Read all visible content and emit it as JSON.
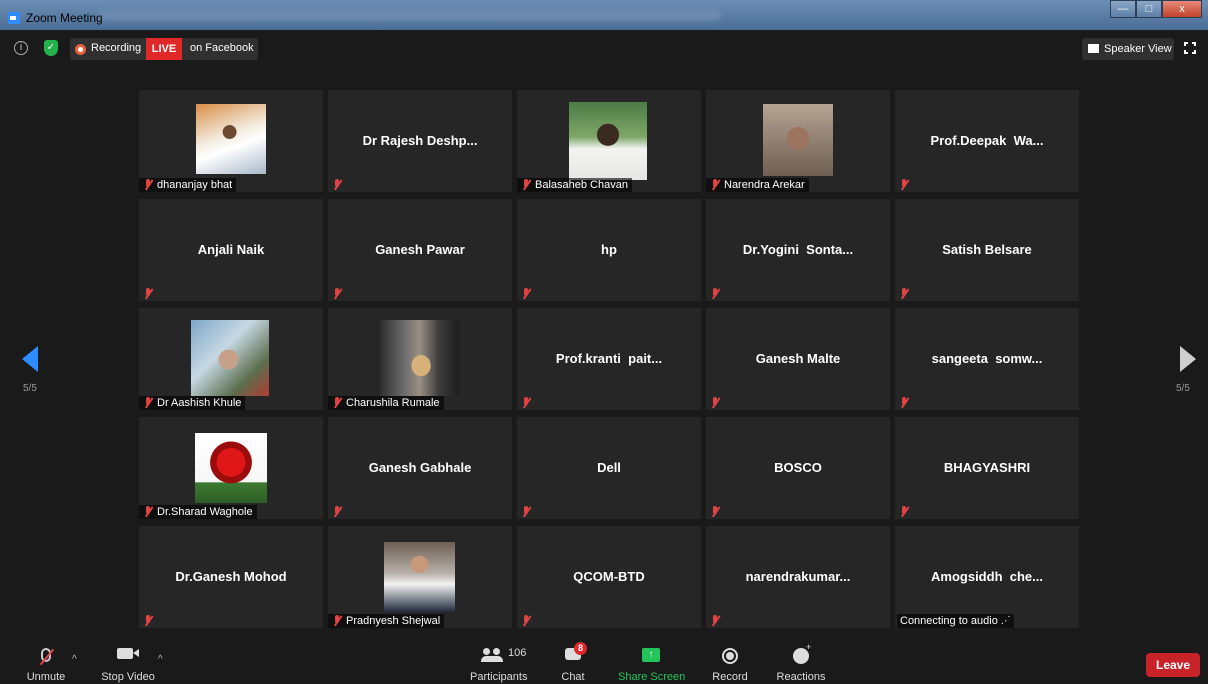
{
  "window": {
    "title": "Zoom Meeting",
    "minimize": "—",
    "maximize": "□",
    "close": "x"
  },
  "topbar": {
    "info_icon": "i",
    "shield_icon": "✓",
    "recording": "Recording",
    "live": "LIVE",
    "live_target": "on Facebook",
    "speaker_view": "Speaker View"
  },
  "pager": {
    "left": "5/5",
    "right": "5/5"
  },
  "tiles": [
    {
      "name": "dhananjay bhat",
      "muted": true,
      "photo": "p1"
    },
    {
      "name": "Dr Rajesh Deshp...",
      "muted": true
    },
    {
      "name": "Balasaheb Chavan",
      "muted": true,
      "photo": "p3"
    },
    {
      "name": "Narendra Arekar",
      "muted": true,
      "photo": "p4"
    },
    {
      "name": "Prof.Deepak  Wa...",
      "muted": true
    },
    {
      "name": "Anjali Naik",
      "muted": true
    },
    {
      "name": "Ganesh Pawar",
      "muted": true
    },
    {
      "name": "hp",
      "muted": true
    },
    {
      "name": "Dr.Yogini  Sonta...",
      "muted": true
    },
    {
      "name": "Satish Belsare",
      "muted": true
    },
    {
      "name": "Dr Aashish Khule",
      "muted": true,
      "photo": "p11"
    },
    {
      "name": "Charushila Rumale",
      "muted": true,
      "photo": "p12"
    },
    {
      "name": "Prof.kranti  pait...",
      "muted": true
    },
    {
      "name": "Ganesh Malte",
      "muted": true
    },
    {
      "name": "sangeeta  somw...",
      "muted": true
    },
    {
      "name": "Dr.Sharad Waghole",
      "muted": true,
      "photo": "p16"
    },
    {
      "name": "Ganesh Gabhale",
      "muted": true
    },
    {
      "name": "Dell",
      "muted": true
    },
    {
      "name": "BOSCO",
      "muted": true
    },
    {
      "name": "BHAGYASHRI",
      "muted": true
    },
    {
      "name": "Dr.Ganesh Mohod",
      "muted": true
    },
    {
      "name": "Pradnyesh Shejwal",
      "muted": true,
      "photo": "p22"
    },
    {
      "name": "QCOM-BTD",
      "muted": true
    },
    {
      "name": "narendrakumar...",
      "muted": true
    },
    {
      "name": "Amogsiddh  che...",
      "muted": false,
      "status": "Connecting to audio .·˙"
    }
  ],
  "toolbar": {
    "unmute": "Unmute",
    "stop_video": "Stop Video",
    "participants": "Participants",
    "participant_count": "106",
    "chat": "Chat",
    "chat_badge": "8",
    "share_screen": "Share Screen",
    "share_icon": "↑",
    "record": "Record",
    "reactions": "Reactions",
    "leave": "Leave",
    "caret": "^"
  },
  "colors": {
    "accent": "#2d8cff",
    "share": "#23c55a",
    "leave": "#c9232a",
    "live": "#e02828",
    "muted": "#e04343"
  }
}
